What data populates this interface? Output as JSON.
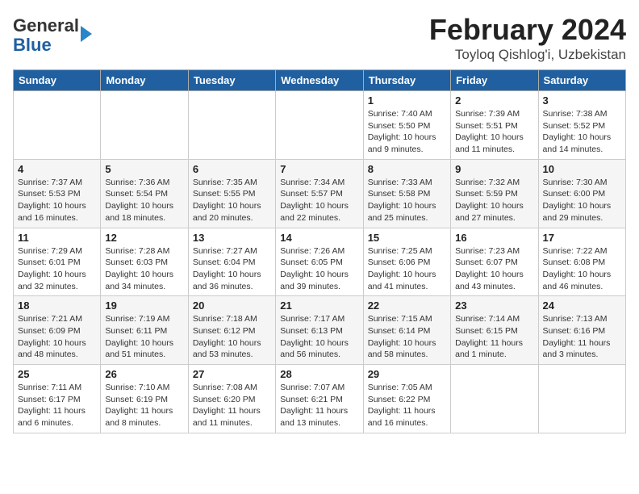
{
  "logo": {
    "general": "General",
    "blue": "Blue"
  },
  "title": "February 2024",
  "subtitle": "Toyloq Qishlog'i, Uzbekistan",
  "days_of_week": [
    "Sunday",
    "Monday",
    "Tuesday",
    "Wednesday",
    "Thursday",
    "Friday",
    "Saturday"
  ],
  "weeks": [
    [
      {
        "day": "",
        "detail": ""
      },
      {
        "day": "",
        "detail": ""
      },
      {
        "day": "",
        "detail": ""
      },
      {
        "day": "",
        "detail": ""
      },
      {
        "day": "1",
        "detail": "Sunrise: 7:40 AM\nSunset: 5:50 PM\nDaylight: 10 hours and 9 minutes."
      },
      {
        "day": "2",
        "detail": "Sunrise: 7:39 AM\nSunset: 5:51 PM\nDaylight: 10 hours and 11 minutes."
      },
      {
        "day": "3",
        "detail": "Sunrise: 7:38 AM\nSunset: 5:52 PM\nDaylight: 10 hours and 14 minutes."
      }
    ],
    [
      {
        "day": "4",
        "detail": "Sunrise: 7:37 AM\nSunset: 5:53 PM\nDaylight: 10 hours and 16 minutes."
      },
      {
        "day": "5",
        "detail": "Sunrise: 7:36 AM\nSunset: 5:54 PM\nDaylight: 10 hours and 18 minutes."
      },
      {
        "day": "6",
        "detail": "Sunrise: 7:35 AM\nSunset: 5:55 PM\nDaylight: 10 hours and 20 minutes."
      },
      {
        "day": "7",
        "detail": "Sunrise: 7:34 AM\nSunset: 5:57 PM\nDaylight: 10 hours and 22 minutes."
      },
      {
        "day": "8",
        "detail": "Sunrise: 7:33 AM\nSunset: 5:58 PM\nDaylight: 10 hours and 25 minutes."
      },
      {
        "day": "9",
        "detail": "Sunrise: 7:32 AM\nSunset: 5:59 PM\nDaylight: 10 hours and 27 minutes."
      },
      {
        "day": "10",
        "detail": "Sunrise: 7:30 AM\nSunset: 6:00 PM\nDaylight: 10 hours and 29 minutes."
      }
    ],
    [
      {
        "day": "11",
        "detail": "Sunrise: 7:29 AM\nSunset: 6:01 PM\nDaylight: 10 hours and 32 minutes."
      },
      {
        "day": "12",
        "detail": "Sunrise: 7:28 AM\nSunset: 6:03 PM\nDaylight: 10 hours and 34 minutes."
      },
      {
        "day": "13",
        "detail": "Sunrise: 7:27 AM\nSunset: 6:04 PM\nDaylight: 10 hours and 36 minutes."
      },
      {
        "day": "14",
        "detail": "Sunrise: 7:26 AM\nSunset: 6:05 PM\nDaylight: 10 hours and 39 minutes."
      },
      {
        "day": "15",
        "detail": "Sunrise: 7:25 AM\nSunset: 6:06 PM\nDaylight: 10 hours and 41 minutes."
      },
      {
        "day": "16",
        "detail": "Sunrise: 7:23 AM\nSunset: 6:07 PM\nDaylight: 10 hours and 43 minutes."
      },
      {
        "day": "17",
        "detail": "Sunrise: 7:22 AM\nSunset: 6:08 PM\nDaylight: 10 hours and 46 minutes."
      }
    ],
    [
      {
        "day": "18",
        "detail": "Sunrise: 7:21 AM\nSunset: 6:09 PM\nDaylight: 10 hours and 48 minutes."
      },
      {
        "day": "19",
        "detail": "Sunrise: 7:19 AM\nSunset: 6:11 PM\nDaylight: 10 hours and 51 minutes."
      },
      {
        "day": "20",
        "detail": "Sunrise: 7:18 AM\nSunset: 6:12 PM\nDaylight: 10 hours and 53 minutes."
      },
      {
        "day": "21",
        "detail": "Sunrise: 7:17 AM\nSunset: 6:13 PM\nDaylight: 10 hours and 56 minutes."
      },
      {
        "day": "22",
        "detail": "Sunrise: 7:15 AM\nSunset: 6:14 PM\nDaylight: 10 hours and 58 minutes."
      },
      {
        "day": "23",
        "detail": "Sunrise: 7:14 AM\nSunset: 6:15 PM\nDaylight: 11 hours and 1 minute."
      },
      {
        "day": "24",
        "detail": "Sunrise: 7:13 AM\nSunset: 6:16 PM\nDaylight: 11 hours and 3 minutes."
      }
    ],
    [
      {
        "day": "25",
        "detail": "Sunrise: 7:11 AM\nSunset: 6:17 PM\nDaylight: 11 hours and 6 minutes."
      },
      {
        "day": "26",
        "detail": "Sunrise: 7:10 AM\nSunset: 6:19 PM\nDaylight: 11 hours and 8 minutes."
      },
      {
        "day": "27",
        "detail": "Sunrise: 7:08 AM\nSunset: 6:20 PM\nDaylight: 11 hours and 11 minutes."
      },
      {
        "day": "28",
        "detail": "Sunrise: 7:07 AM\nSunset: 6:21 PM\nDaylight: 11 hours and 13 minutes."
      },
      {
        "day": "29",
        "detail": "Sunrise: 7:05 AM\nSunset: 6:22 PM\nDaylight: 11 hours and 16 minutes."
      },
      {
        "day": "",
        "detail": ""
      },
      {
        "day": "",
        "detail": ""
      }
    ]
  ]
}
